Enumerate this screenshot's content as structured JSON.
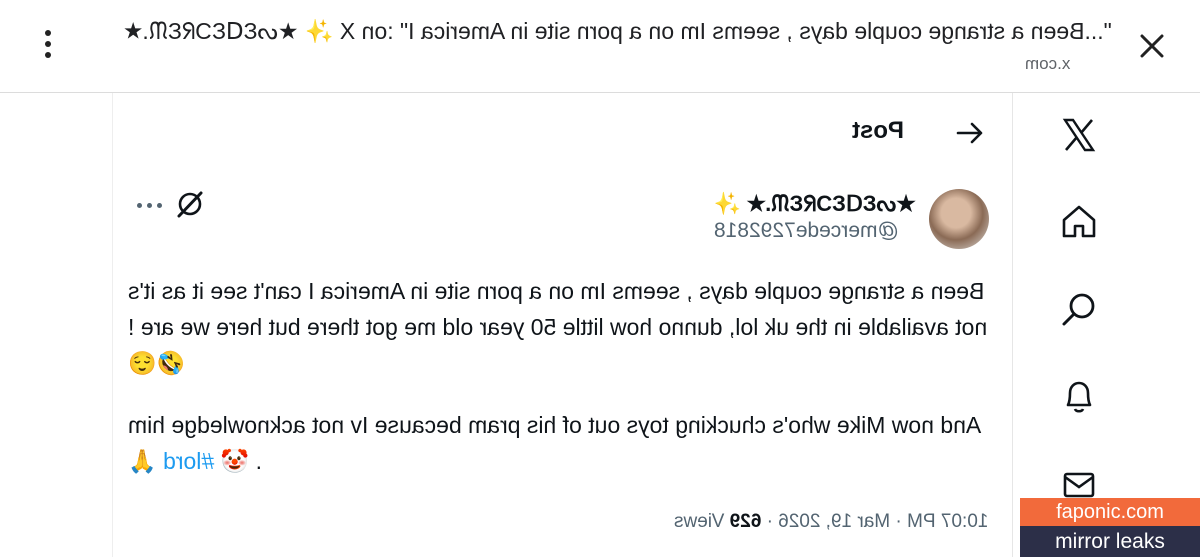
{
  "browser": {
    "page_title": "\"...Been a strange couple days , seems Im on a porn site in America I\" :on X ✨ ★ᔕƐᗡƐƆᖇƐᙏ.★",
    "domain": "x.com"
  },
  "header": {
    "title": "Post"
  },
  "post": {
    "author_name": "★ᔕƐᗡƐƆᖇƐᙏ.★ ✨",
    "author_handle": "@mercede7292818",
    "paragraph1": "Been a strange couple days , seems Im on a porn site in America I can't see it as it's not available in the uk lol, dunno how little 50 year old me got there but here we are ! 🤣😌",
    "paragraph2_text": "And now Mike who's chucking toys out of his pram because Iv not acknowledge him . 🤡",
    "hashtag": "#lord",
    "trailing_emoji": "🙏",
    "time": "10:07 PM · Mar 19, 2026 ·",
    "views_count": "629",
    "views_label": "Views"
  },
  "watermark": {
    "line1": "faponic.com",
    "line2": "mirror leaks"
  },
  "icons": [
    "kebab-menu-icon",
    "close-icon",
    "x-logo-icon",
    "home-icon",
    "search-icon",
    "bell-icon",
    "mail-icon",
    "grok-icon",
    "more-icon",
    "back-arrow-icon"
  ]
}
